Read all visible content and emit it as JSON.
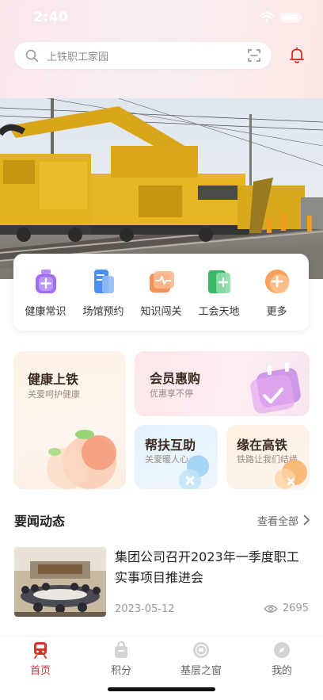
{
  "status": {
    "time": "2:40"
  },
  "search": {
    "placeholder": "上铁职工家园"
  },
  "quick_menu": [
    {
      "label": "健康常识",
      "icon": "health-bottle-icon"
    },
    {
      "label": "场馆预约",
      "icon": "venue-booking-icon"
    },
    {
      "label": "知识闯关",
      "icon": "knowledge-challenge-icon"
    },
    {
      "label": "工会天地",
      "icon": "union-book-icon"
    },
    {
      "label": "更多",
      "icon": "more-plus-icon"
    }
  ],
  "cards": {
    "health": {
      "title": "健康上铁",
      "subtitle": "关爱呵护健康"
    },
    "member": {
      "title": "会员惠购",
      "subtitle": "优惠享不停"
    },
    "help": {
      "title": "帮扶互助",
      "subtitle": "关爱暖人心"
    },
    "rail": {
      "title": "缘在高铁",
      "subtitle": "铁路让我们结缘"
    }
  },
  "news": {
    "section_title": "要闻动态",
    "see_all": "查看全部",
    "items": [
      {
        "title": "集团公司召开2023年一季度职工实事项目推进会",
        "date": "2023-05-12",
        "views": "2695"
      }
    ]
  },
  "tabs": [
    {
      "label": "首页",
      "icon": "train-icon",
      "active": true
    },
    {
      "label": "积分",
      "icon": "points-bag-icon",
      "active": false
    },
    {
      "label": "基层之窗",
      "icon": "badge-icon",
      "active": false
    },
    {
      "label": "我的",
      "icon": "compass-icon",
      "active": false
    }
  ],
  "colors": {
    "accent": "#d9302a",
    "bell": "#d9302a"
  }
}
